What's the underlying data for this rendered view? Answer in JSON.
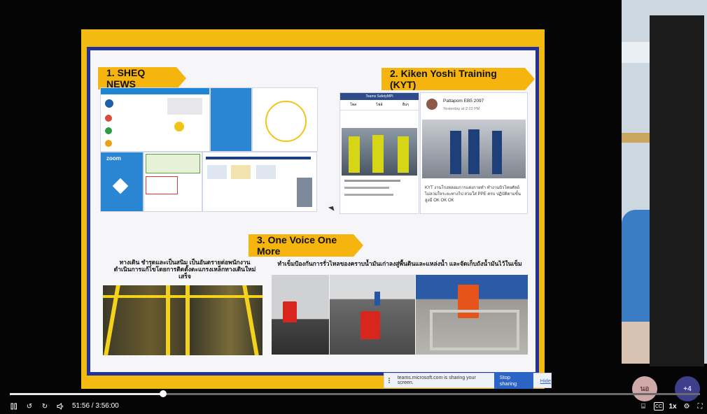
{
  "slide": {
    "section1_title": "1. SHEQ NEWS",
    "section2_title": "2. Kiken Yoshi Training (KYT)",
    "section3_title": "3. One Voice One More",
    "left_caption": "ทางเดิน ชำรุดและเป็นสนิม เป็นอันตรายต่อพนักงาน ดำเนินการแก้ไขโดยการติดตั้งตะแกรงเหล็กทางเดินใหม่เสร็จ",
    "right_caption": "ทำเข็มป้องกันการรั่วไหลของคราบน้ำมันเก่าลงสู่พื้นดินและแหล่งน้ำ และจัดเก็บถังน้ำมันไว้ในเข็ม",
    "kyt_left_app_title": "Teams SafetyMPI",
    "kyt_left_tabs": [
      "โพส",
      "ไฟล์",
      "อื่นๆ"
    ],
    "kyt_poster_name": "Pattapom EB5 2097",
    "kyt_poster_time": "Yesterday at 2:23 PM",
    "kyt_post_text": "KYT งานโรงหลอมการแต่งกายทำ ทำงานบิวไทยศัลย์ ไม่ลวมใจระยะทางไป สวมใส่ PPE ครบ ปฏิบัติตามขั้นสูงมี OK OK OK",
    "zoom_label": "zoom"
  },
  "share_bar": {
    "message": "teams.microsoft.com is sharing your screen.",
    "stop_label": "Stop sharing",
    "hide_label": "Hide"
  },
  "player": {
    "time": "51:56 / 3:56:00",
    "progress": 0.222,
    "speed": "1x",
    "cc_label": "CC"
  },
  "participants": {
    "avatar_initials": "นอ",
    "more_count": "+4"
  },
  "colors": {
    "accent_yellow": "#f5b40e",
    "slide_border_blue": "#23329a",
    "teams_blue": "#2b63c7",
    "avatar_pink": "#cfa8a8",
    "avatar_purple": "#3d3f8c"
  }
}
